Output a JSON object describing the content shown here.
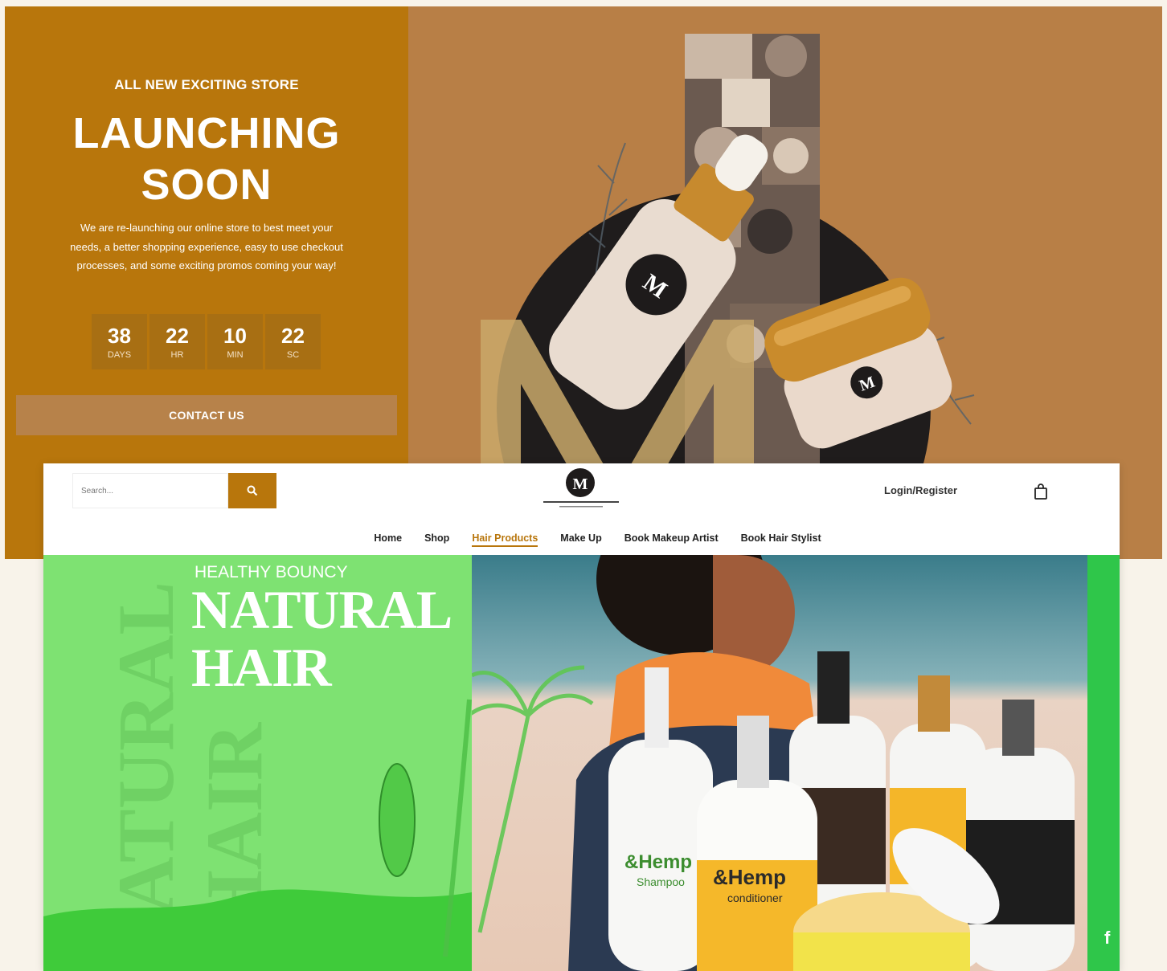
{
  "launch": {
    "eyebrow": "ALL NEW EXCITING STORE",
    "title_line1": "LAUNCHING",
    "title_line2": "SOON",
    "description": "We are re-launching our online store to best meet your needs, a better shopping experience, easy to use checkout processes, and some exciting promos coming your way!",
    "countdown": [
      {
        "value": "38",
        "label": "DAYS"
      },
      {
        "value": "22",
        "label": "HR"
      },
      {
        "value": "10",
        "label": "MIN"
      },
      {
        "value": "22",
        "label": "SC"
      }
    ],
    "contact_label": "CONTACT US"
  },
  "store": {
    "search_placeholder": "Search...",
    "login_label": "Login/Register",
    "nav": [
      {
        "label": "Home",
        "active": false
      },
      {
        "label": "Shop",
        "active": false
      },
      {
        "label": "Hair Products",
        "active": true
      },
      {
        "label": "Make Up",
        "active": false
      },
      {
        "label": "Book Makeup Artist",
        "active": false
      },
      {
        "label": "Book Hair Stylist",
        "active": false
      }
    ]
  },
  "hero": {
    "eyebrow": "HEALTHY BOUNCY",
    "title_line1": "NATURAL",
    "title_line2": "HAIR",
    "watermark_line1": "NATURAL",
    "watermark_line2": "HAIR",
    "product_brand": "&Hemp",
    "product_labels": [
      "Shampoo",
      "conditioner"
    ],
    "social_icon": "facebook-icon"
  },
  "colors": {
    "brand_gold": "#b8760c",
    "panel_tan": "#b87f46",
    "hero_green": "#7ee272"
  }
}
